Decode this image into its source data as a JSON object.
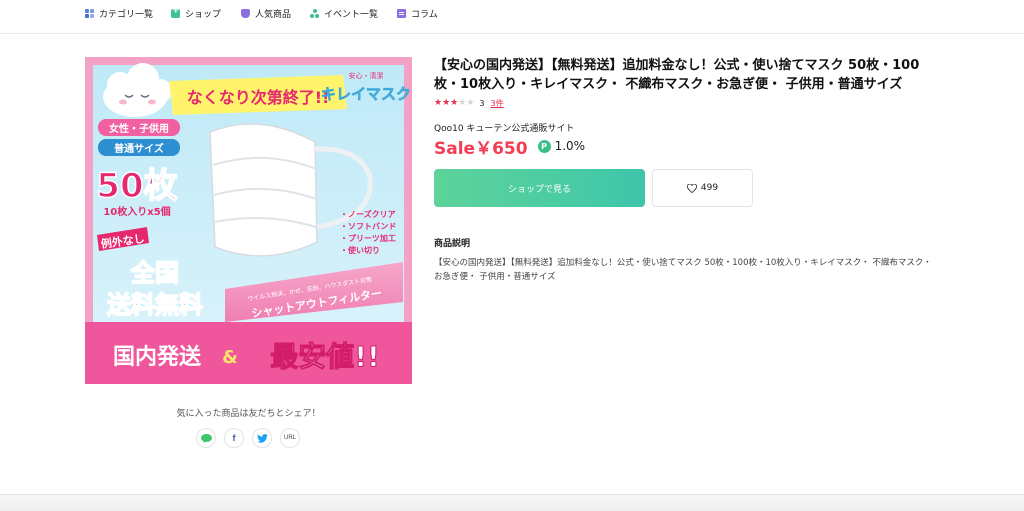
{
  "nav": {
    "items": [
      {
        "label": "カテゴリ一覧"
      },
      {
        "label": "ショップ"
      },
      {
        "label": "人気商品"
      },
      {
        "label": "イベント一覧"
      },
      {
        "label": "コラム"
      }
    ]
  },
  "image": {
    "banner_top": "なくなり次第終了!!",
    "tag_small": "安心・清潔",
    "product_name": "キレイマスク",
    "badge_1": "女性・子供用",
    "badge_2": "普通サイズ",
    "count_big": "50枚",
    "count_sub": "10枚入りx5個",
    "ribbon": "例外なし",
    "free_ship_1": "全国",
    "free_ship_2": "送料無料",
    "features": [
      "・ノーズクリア",
      "・ソフトバンド",
      "・プリーツ加工",
      "・使い切り"
    ],
    "filter_small": "ウイルス飛沫、かぜ、花粉、ハウスダスト対策",
    "filter_big": "シャットアウトフィルター",
    "bottom_left": "国内発送",
    "bottom_amp": "&",
    "bottom_right": "最安値!!"
  },
  "share": {
    "text": "気に入った商品は友だちとシェア！",
    "line": "LINE",
    "facebook": "f",
    "twitter": "t",
    "url": "URL"
  },
  "product": {
    "title": "【安心の国内発送】【無料発送】追加料金なし！公式・使い捨てマスク 50枚・100枚・10枚入り・キレイマスク・ 不織布マスク・お急ぎ便・ 子供用・普通サイズ",
    "rating": 3,
    "rating_text": "3",
    "review_count": "3件",
    "seller": "Qoo10 キューテン公式通販サイト",
    "price": "Sale￥650",
    "point_icon": "P",
    "point_rate": "1.0%",
    "shop_button": "ショップで見る",
    "like_count": "499",
    "desc_heading": "商品説明",
    "desc_body": "【安心の国内発送】【無料発送】追加料金なし！公式・使い捨てマスク 50枚・100枚・10枚入り・キレイマスク・ 不織布マスク・お急ぎ便・ 子供用・普通サイズ"
  },
  "colors": {
    "price": "#f23d52",
    "accent_green": "#3ec6aa",
    "star_on": "#e6304b",
    "star_off": "#d6d6d6"
  }
}
